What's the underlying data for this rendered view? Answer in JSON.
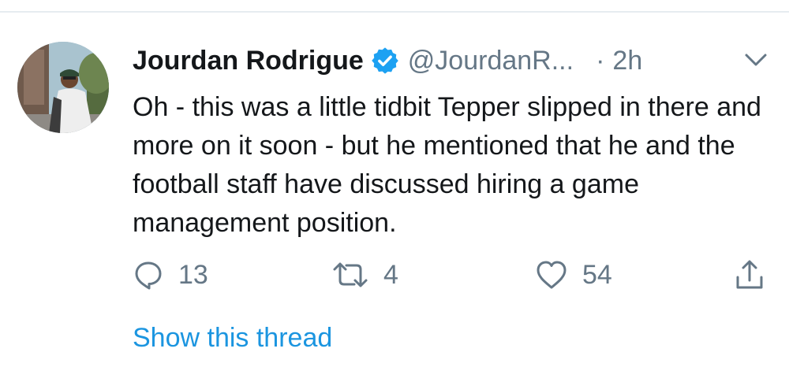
{
  "tweet": {
    "author_name": "Jourdan Rodrigue",
    "author_handle": "@JourdanR...",
    "separator": "·",
    "timestamp": "2h",
    "text": "Oh - this was a little tidbit Tepper slipped in there and more on it soon - but he mentioned that he and the football staff have discussed hiring a game management position.",
    "verified": true
  },
  "actions": {
    "reply_count": "13",
    "retweet_count": "4",
    "like_count": "54"
  },
  "footer": {
    "show_thread_label": "Show this thread"
  },
  "icons": {
    "verified": "verified-badge-icon",
    "menu": "chevron-down-icon",
    "reply": "reply-icon",
    "retweet": "retweet-icon",
    "like": "heart-icon",
    "share": "share-icon"
  },
  "colors": {
    "text": "#14171a",
    "secondary": "#657786",
    "link": "#1b95e0",
    "verified": "#1da1f2",
    "divider": "#e6ecf0"
  }
}
